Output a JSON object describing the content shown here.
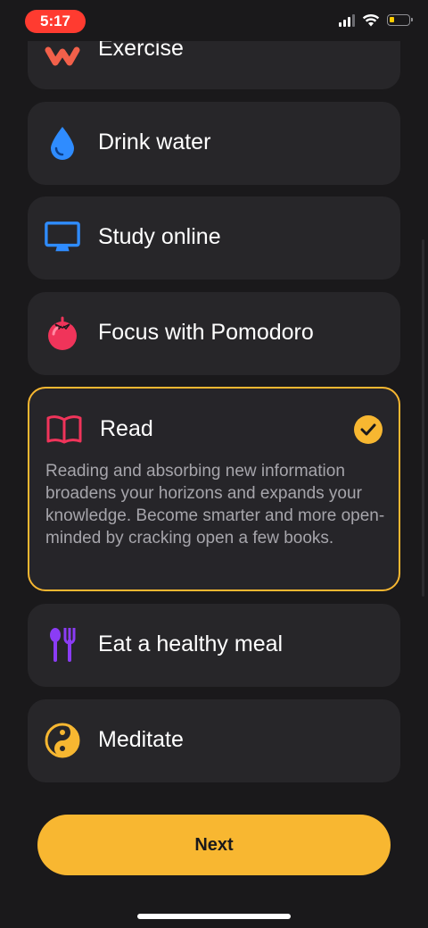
{
  "status_bar": {
    "time": "5:17"
  },
  "habits": [
    {
      "label": "Exercise",
      "icon": "exercise-squiggle-icon"
    },
    {
      "label": "Drink water",
      "icon": "water-drop-icon"
    },
    {
      "label": "Study online",
      "icon": "monitor-icon"
    },
    {
      "label": "Focus with Pomodoro",
      "icon": "tomato-icon"
    },
    {
      "label": "Read",
      "icon": "open-book-icon",
      "selected": true,
      "description": "Reading and absorbing new information broadens your horizons and expands your knowledge. Become smarter and more open-minded by cracking open a few books."
    },
    {
      "label": "Eat a healthy meal",
      "icon": "spoon-fork-icon"
    },
    {
      "label": "Meditate",
      "icon": "yin-yang-icon"
    }
  ],
  "next_button": {
    "label": "Next"
  },
  "colors": {
    "background": "#1a191b",
    "card": "#272629",
    "accent": "#f7b731",
    "description_text": "#a6a5ab",
    "status_time_pill": "#ff3b30"
  }
}
